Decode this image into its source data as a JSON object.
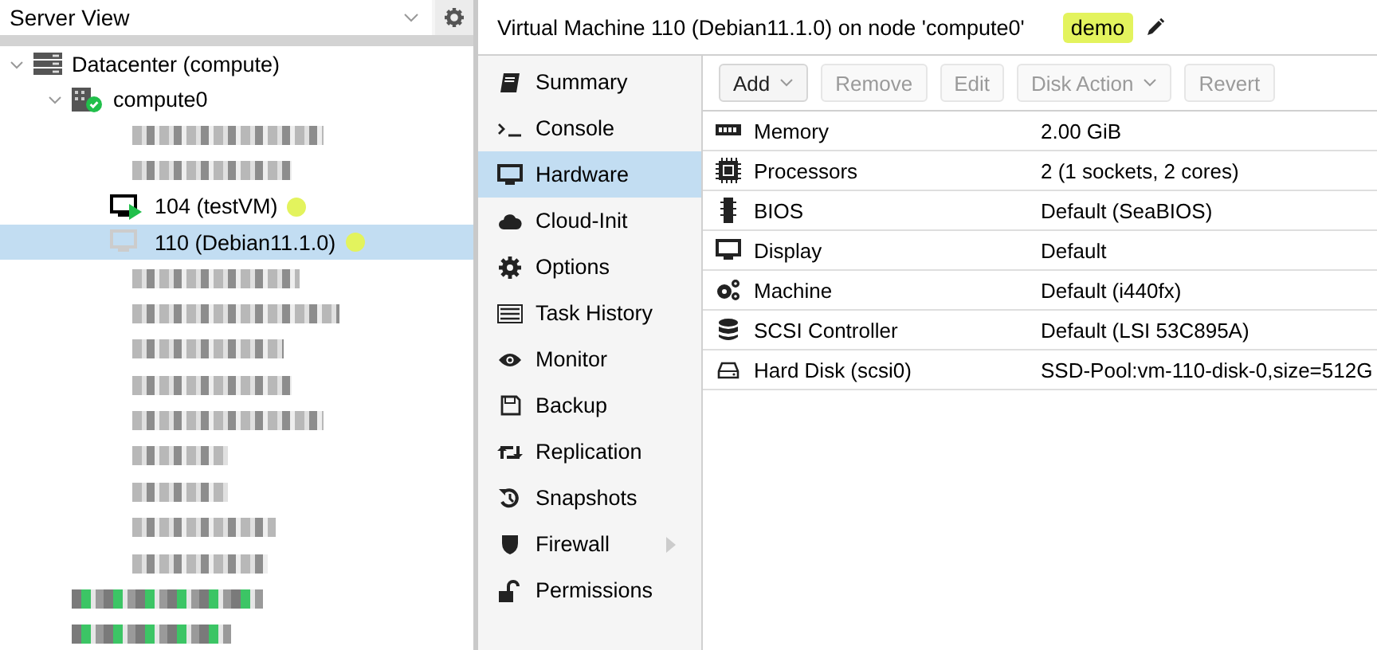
{
  "view_selector": {
    "value": "Server View"
  },
  "tree": [
    {
      "kind": "datacenter",
      "label": "Datacenter (compute)",
      "expanded": true,
      "selected": false,
      "children": [
        {
          "kind": "node",
          "label": "compute0",
          "expanded": true,
          "selected": false,
          "online": true,
          "children": [
            {
              "kind": "redacted",
              "selected": false
            },
            {
              "kind": "redacted",
              "selected": false
            },
            {
              "kind": "vm",
              "label": "104 (testVM)",
              "running": true,
              "selected": false,
              "color": "#e3f35d"
            },
            {
              "kind": "vm",
              "label": "110 (Debian11.1.0)",
              "running": false,
              "selected": true,
              "color": "#e3f35d"
            },
            {
              "kind": "redacted",
              "selected": false
            },
            {
              "kind": "redacted",
              "selected": false
            },
            {
              "kind": "redacted",
              "selected": false
            },
            {
              "kind": "redacted",
              "selected": false
            },
            {
              "kind": "redacted",
              "selected": false
            },
            {
              "kind": "redacted",
              "selected": false
            },
            {
              "kind": "redacted",
              "selected": false
            },
            {
              "kind": "redacted",
              "selected": false
            },
            {
              "kind": "redacted",
              "selected": false
            }
          ]
        },
        {
          "kind": "redacted-node",
          "selected": false
        },
        {
          "kind": "redacted-node",
          "selected": false
        }
      ]
    }
  ],
  "header": {
    "title": "Virtual Machine 110 (Debian11.1.0) on node 'compute0'",
    "tag": {
      "label": "demo",
      "color": "#e3f35d"
    }
  },
  "nav": [
    {
      "kind": "book",
      "label": "Summary",
      "selected": false
    },
    {
      "kind": "terminal",
      "label": "Console",
      "selected": false
    },
    {
      "kind": "monitor",
      "label": "Hardware",
      "selected": true
    },
    {
      "kind": "cloud",
      "label": "Cloud-Init",
      "selected": false
    },
    {
      "kind": "gear",
      "label": "Options",
      "selected": false
    },
    {
      "kind": "list",
      "label": "Task History",
      "selected": false
    },
    {
      "kind": "eye",
      "label": "Monitor",
      "selected": false
    },
    {
      "kind": "floppy",
      "label": "Backup",
      "selected": false
    },
    {
      "kind": "retweet",
      "label": "Replication",
      "selected": false
    },
    {
      "kind": "history",
      "label": "Snapshots",
      "selected": false
    },
    {
      "kind": "shield",
      "label": "Firewall",
      "selected": false,
      "has_submenu": true
    },
    {
      "kind": "unlock",
      "label": "Permissions",
      "selected": false
    }
  ],
  "toolbar": [
    {
      "label": "Add",
      "disabled": false,
      "dropdown": true
    },
    {
      "label": "Remove",
      "disabled": true,
      "dropdown": false
    },
    {
      "label": "Edit",
      "disabled": true,
      "dropdown": false
    },
    {
      "label": "Disk Action",
      "disabled": true,
      "dropdown": true
    },
    {
      "label": "Revert",
      "disabled": true,
      "dropdown": false
    }
  ],
  "hardware": [
    {
      "kind": "memory",
      "name": "Memory",
      "value": "2.00 GiB"
    },
    {
      "kind": "cpu",
      "name": "Processors",
      "value": "2 (1 sockets, 2 cores)"
    },
    {
      "kind": "chip",
      "name": "BIOS",
      "value": "Default (SeaBIOS)"
    },
    {
      "kind": "monitor",
      "name": "Display",
      "value": "Default"
    },
    {
      "kind": "gears",
      "name": "Machine",
      "value": "Default (i440fx)"
    },
    {
      "kind": "database",
      "name": "SCSI Controller",
      "value": "Default (LSI 53C895A)"
    },
    {
      "kind": "hdd",
      "name": "Hard Disk (scsi0)",
      "value": "SSD-Pool:vm-110-disk-0,size=512G"
    }
  ]
}
